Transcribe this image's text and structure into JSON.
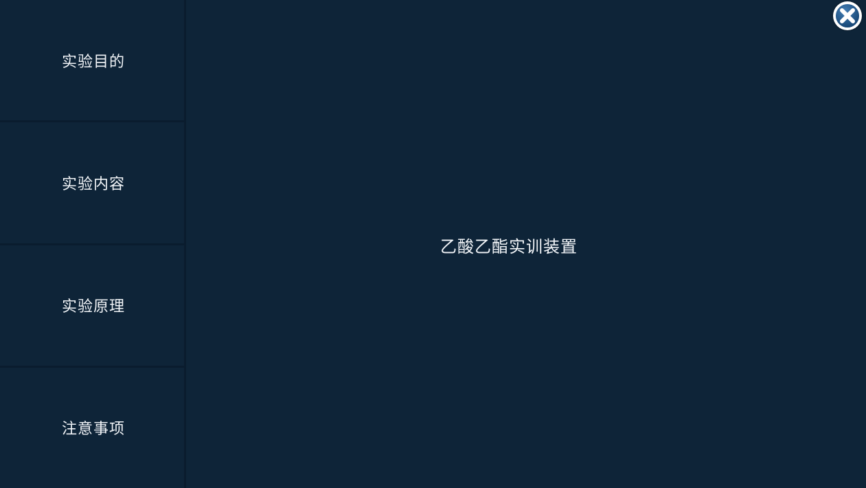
{
  "sidebar": {
    "items": [
      {
        "label": "实验目的"
      },
      {
        "label": "实验内容"
      },
      {
        "label": "实验原理"
      },
      {
        "label": "注意事项"
      }
    ]
  },
  "main": {
    "title": "乙酸乙酯实训装置"
  },
  "icons": {
    "close": "close-icon"
  },
  "colors": {
    "background": "#0e2438",
    "divider": "#0a1c2e",
    "text": "#f2f5f8",
    "close_fill": "#1f5a93"
  }
}
